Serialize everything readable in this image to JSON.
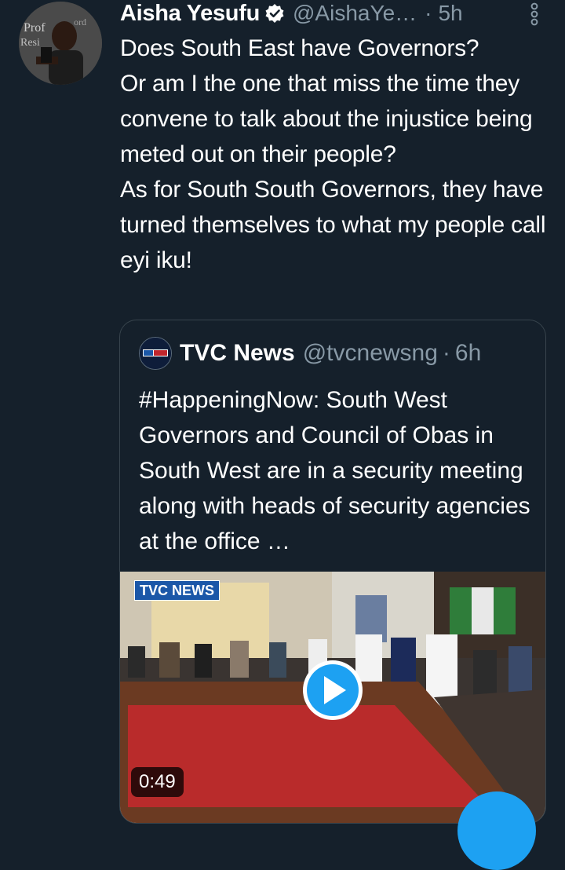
{
  "tweet": {
    "display_name": "Aisha Yesufu",
    "handle": "@AishaYe…",
    "separator": "·",
    "time": "5h",
    "text": "Does South East have Governors?\nOr am I the one that miss the time they convene to talk about the injustice being meted out on their people?\nAs for South South Governors, they have turned themselves to what my people call eyi iku!"
  },
  "quoted": {
    "display_name": "TVC News",
    "handle": "@tvcnewsng",
    "separator": "·",
    "time": "6h",
    "text": "#HappeningNow: South West Governors and Council of Obas in South West are in a security meeting along with heads of security agencies at the office …",
    "video": {
      "duration": "0:49",
      "channel_logo": "TVC NEWS"
    }
  },
  "colors": {
    "background": "#15202b",
    "accent": "#1da1f2",
    "secondary_text": "#8899a6",
    "border": "#38444d"
  },
  "icons": [
    "verified-badge-icon",
    "more-options-icon",
    "play-icon"
  ]
}
